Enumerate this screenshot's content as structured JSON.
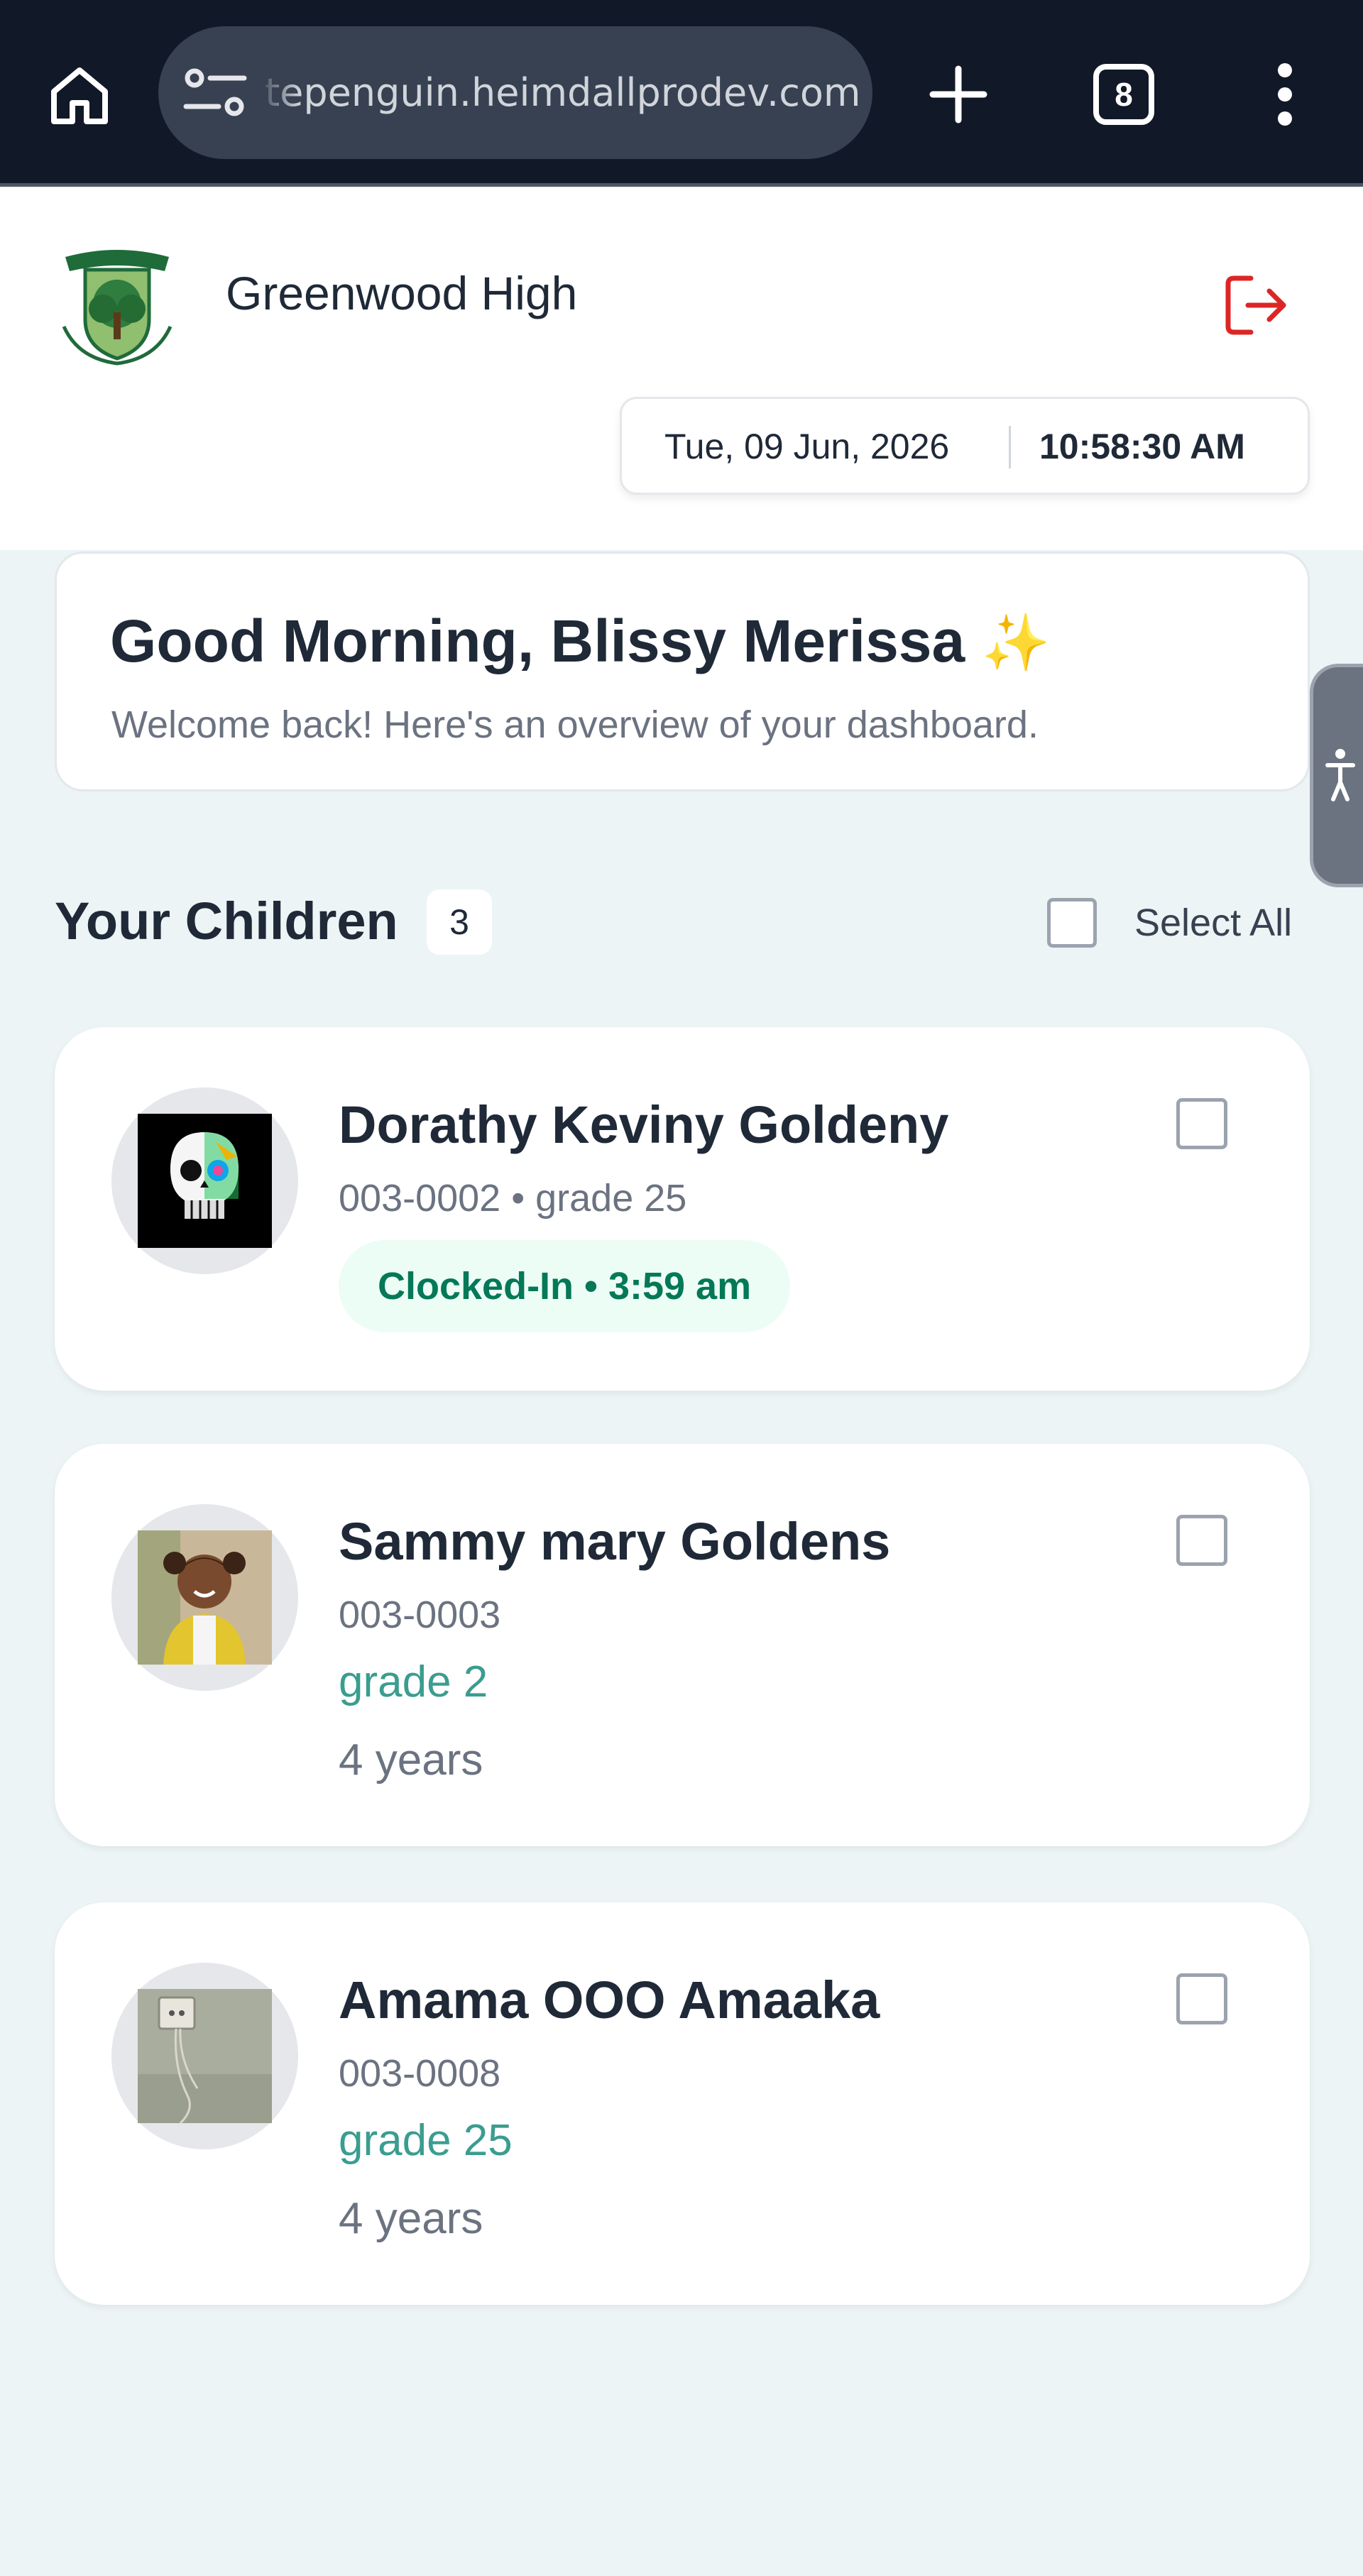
{
  "browser": {
    "url": "tepenguin.heimdallprodev.com",
    "tab_count": "8"
  },
  "header": {
    "school_name": "Greenwood High",
    "date": "Tue, 09 Jun, 2026",
    "time": "10:58:30 AM"
  },
  "greeting": {
    "title": "Good Morning, Blissy Merissa",
    "emoji": "✨",
    "subtitle": "Welcome back! Here's an overview of your dashboard."
  },
  "children_section": {
    "title": "Your Children",
    "count": "3",
    "select_all_label": "Select All"
  },
  "children": [
    {
      "name": "Dorathy Keviny Goldeny",
      "meta": "003-0002 • grade 25",
      "status": "Clocked-In • 3:59 am"
    },
    {
      "name": "Sammy mary Goldens",
      "meta": "003-0003",
      "grade": "grade 2",
      "age": "4 years"
    },
    {
      "name": "Amama OOO Amaaka",
      "meta": "003-0008",
      "grade": "grade 25",
      "age": "4 years"
    }
  ],
  "colors": {
    "background": "#ecf4f5",
    "accent_teal": "#3a9d8f",
    "status_green": "#047857",
    "logout_red": "#dc2626",
    "browser_bar": "#111827"
  },
  "icons": {
    "home": "home-icon",
    "site_settings": "tune-icon",
    "new_tab": "plus-icon",
    "menu": "more-vert-icon",
    "logout": "logout-icon",
    "accessibility": "accessibility-icon"
  }
}
